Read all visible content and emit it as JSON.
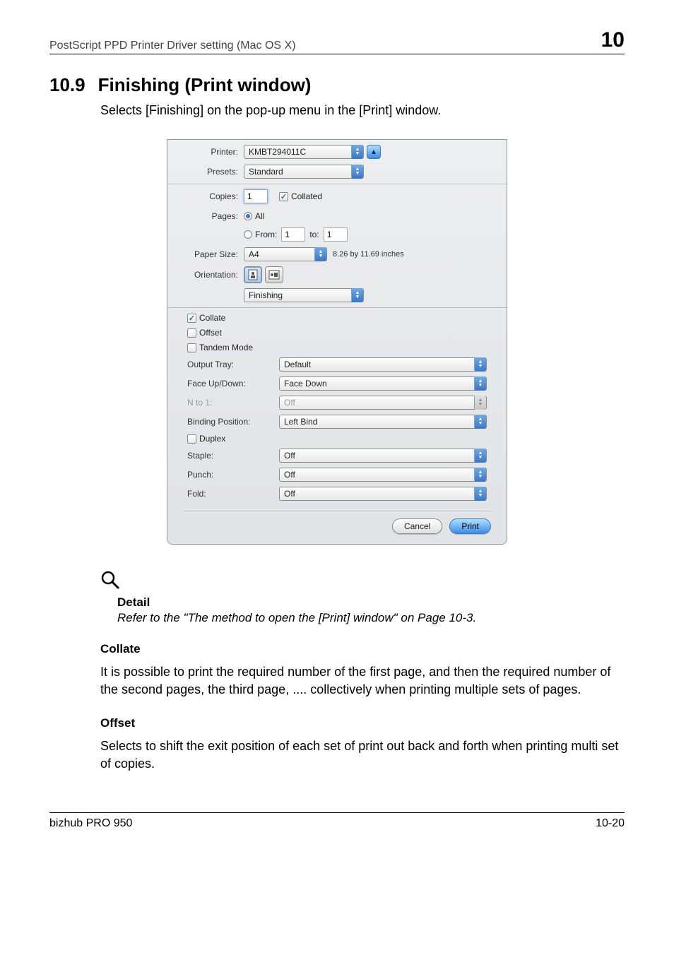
{
  "header": {
    "left": "PostScript PPD Printer Driver setting (Mac OS X)",
    "right": "10"
  },
  "section": {
    "number": "10.9",
    "title": "Finishing (Print window)",
    "desc": "Selects [Finishing] on the pop-up menu in the [Print] window."
  },
  "dialog": {
    "printer": {
      "label": "Printer:",
      "value": "KMBT294011C"
    },
    "presets": {
      "label": "Presets:",
      "value": "Standard"
    },
    "copies": {
      "label": "Copies:",
      "value": "1",
      "collated_label": "Collated",
      "collated_checked": true
    },
    "pages": {
      "label": "Pages:",
      "all_label": "All",
      "from_label": "From:",
      "from_value": "1",
      "to_label": "to:",
      "to_value": "1"
    },
    "paper_size": {
      "label": "Paper Size:",
      "value": "A4",
      "dimensions": "8.26 by 11.69 inches"
    },
    "orientation": {
      "label": "Orientation:"
    },
    "section_select": "Finishing",
    "collate": {
      "label": "Collate",
      "checked": true
    },
    "offset": {
      "label": "Offset",
      "checked": false
    },
    "tandem": {
      "label": "Tandem Mode",
      "checked": false
    },
    "output_tray": {
      "label": "Output Tray:",
      "value": "Default"
    },
    "face": {
      "label": "Face Up/Down:",
      "value": "Face Down"
    },
    "nto1": {
      "label": "N to 1:",
      "value": "Off"
    },
    "binding": {
      "label": "Binding Position:",
      "value": "Left Bind"
    },
    "duplex": {
      "label": "Duplex",
      "checked": false
    },
    "staple": {
      "label": "Staple:",
      "value": "Off"
    },
    "punch": {
      "label": "Punch:",
      "value": "Off"
    },
    "fold": {
      "label": "Fold:",
      "value": "Off"
    },
    "buttons": {
      "cancel": "Cancel",
      "print": "Print"
    }
  },
  "detail": {
    "heading": "Detail",
    "body": "Refer to the \"The method to open the [Print] window\" on Page 10-3."
  },
  "collate_section": {
    "heading": "Collate",
    "body": "It is possible to print the required number of the first page, and then the required number of the second pages, the third page, .... collectively when printing multiple sets of pages."
  },
  "offset_section": {
    "heading": "Offset",
    "body": "Selects to shift the exit position of each set of print out back and forth when printing multi set of copies."
  },
  "footer": {
    "left": "bizhub PRO 950",
    "right": "10-20"
  }
}
